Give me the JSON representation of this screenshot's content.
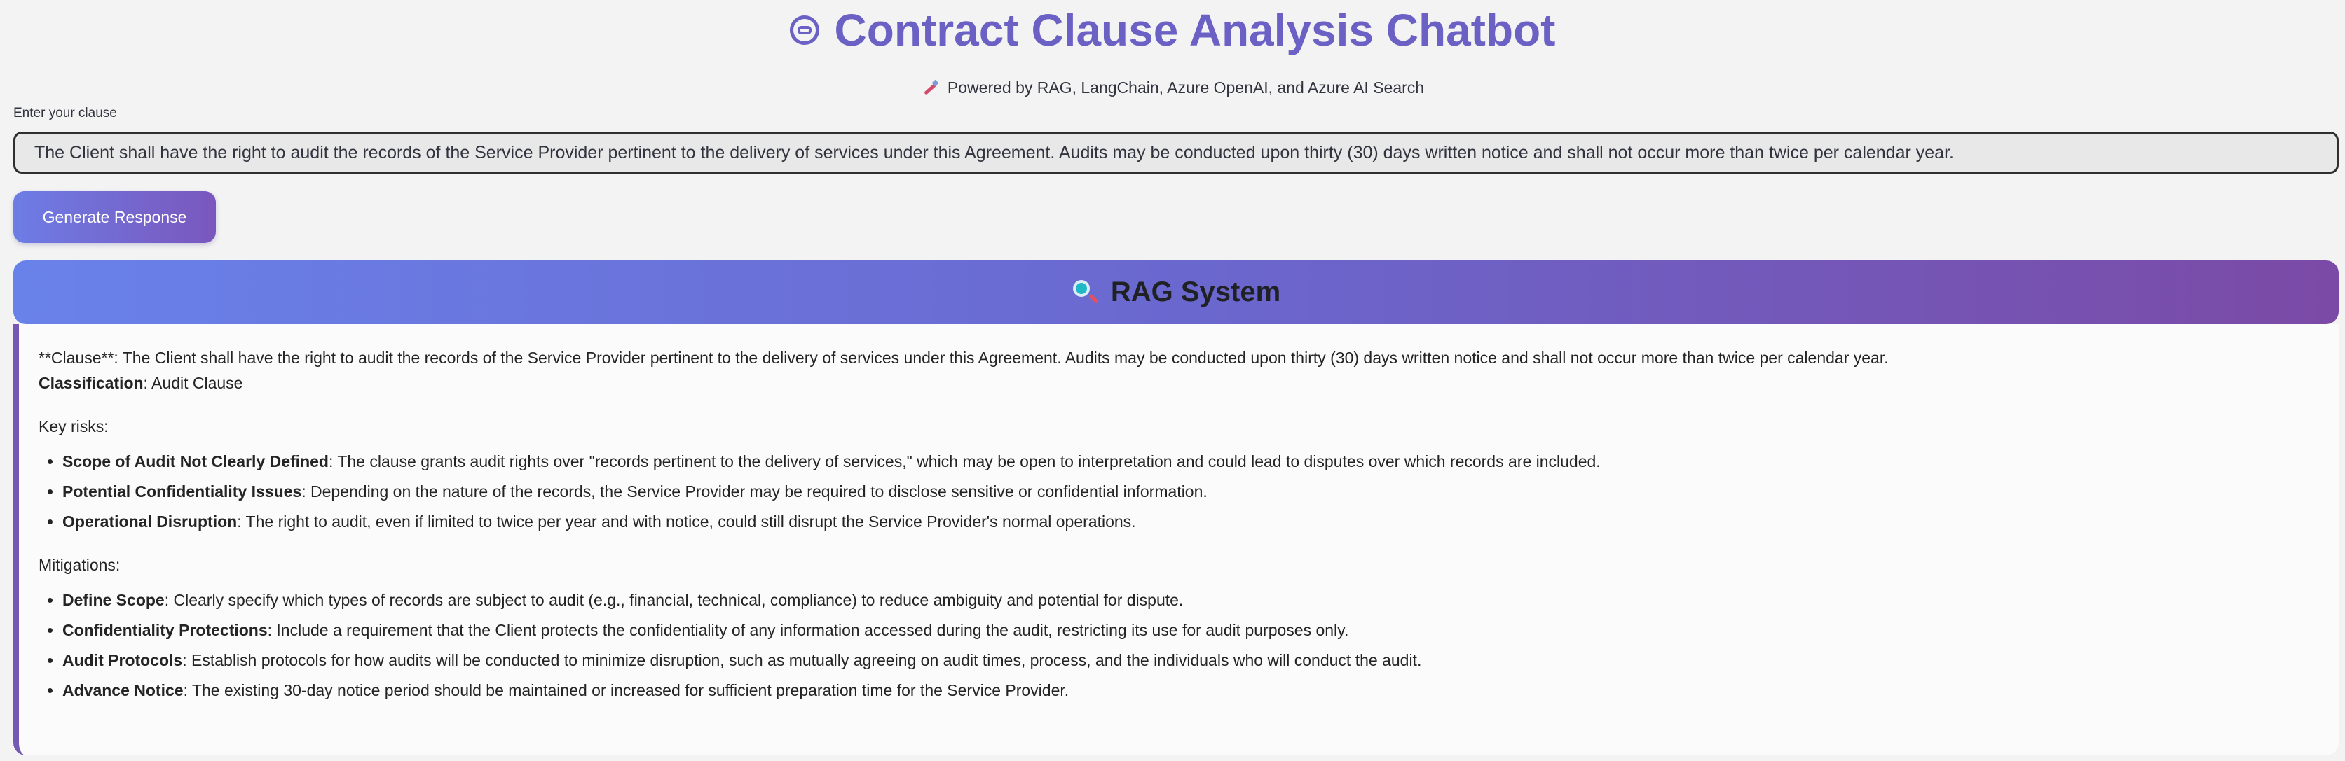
{
  "header": {
    "title": "Contract Clause Analysis Chatbot",
    "subtitle": "Powered by RAG, LangChain, Azure OpenAI, and Azure AI Search",
    "title_icon": "robot-face-icon",
    "subtitle_icon": "syringe-icon"
  },
  "input": {
    "label": "Enter your clause",
    "value": "The Client shall have the right to audit the records of the Service Provider pertinent to the delivery of services under this Agreement. Audits may be conducted upon thirty (30) days written notice and shall not occur more than twice per calendar year."
  },
  "button": {
    "label": "Generate Response"
  },
  "rag": {
    "title": "RAG System",
    "icon": "magnifier-icon"
  },
  "response": {
    "clause_line": "**Clause**: The Client shall have the right to audit the records of the Service Provider pertinent to the delivery of services under this Agreement. Audits may be conducted upon thirty (30) days written notice and shall not occur more than twice per calendar year.",
    "classification_label": "Classification",
    "classification_value": ": Audit Clause",
    "key_risks_title": "Key risks:",
    "key_risks": [
      {
        "title": "Scope of Audit Not Clearly Defined",
        "text": ": The clause grants audit rights over \"records pertinent to the delivery of services,\" which may be open to interpretation and could lead to disputes over which records are included."
      },
      {
        "title": "Potential Confidentiality Issues",
        "text": ": Depending on the nature of the records, the Service Provider may be required to disclose sensitive or confidential information."
      },
      {
        "title": "Operational Disruption",
        "text": ": The right to audit, even if limited to twice per year and with notice, could still disrupt the Service Provider's normal operations."
      }
    ],
    "mitigations_title": "Mitigations:",
    "mitigations": [
      {
        "title": "Define Scope",
        "text": ": Clearly specify which types of records are subject to audit (e.g., financial, technical, compliance) to reduce ambiguity and potential for dispute."
      },
      {
        "title": "Confidentiality Protections",
        "text": ": Include a requirement that the Client protects the confidentiality of any information accessed during the audit, restricting its use for audit purposes only."
      },
      {
        "title": "Audit Protocols",
        "text": ": Establish protocols for how audits will be conducted to minimize disruption, such as mutually agreeing on audit times, process, and the individuals who will conduct the audit."
      },
      {
        "title": "Advance Notice",
        "text": ": The existing 30-day notice period should be maintained or increased for sufficient preparation time for the Service Provider."
      }
    ]
  },
  "colors": {
    "background": "#f3f3f3",
    "title": "#6b61c4",
    "button_gradient_start": "#6d7de5",
    "button_gradient_end": "#7a57bd",
    "panel_accent": "#7557b4"
  }
}
